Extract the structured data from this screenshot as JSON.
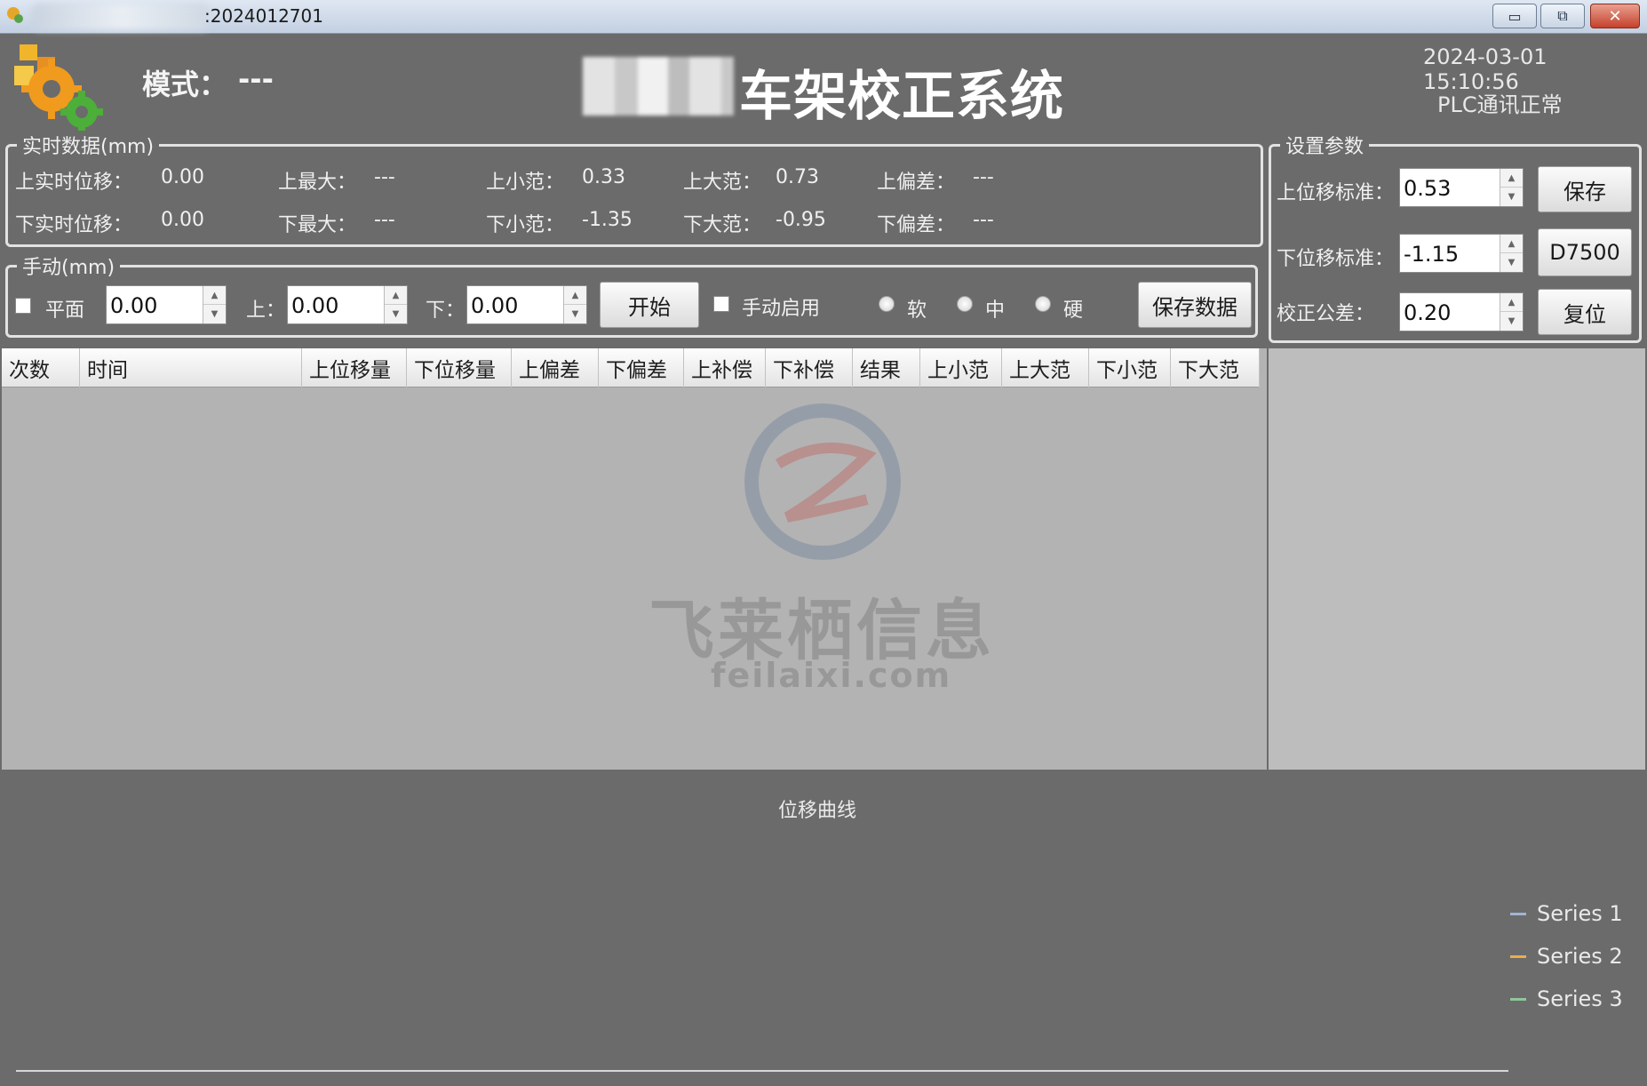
{
  "window": {
    "title_suffix": ":2024012701",
    "min_glyph": "▭",
    "max_glyph": "⧉",
    "close_glyph": "✕"
  },
  "header": {
    "mode_label": "模式：",
    "mode_value": "---",
    "system_title": "车架校正系统",
    "datetime": "2024-03-01 15:10:56",
    "plc_status": "PLC通讯正常"
  },
  "realtime": {
    "group_title": "实时数据(mm)",
    "upper_disp_label": "上实时位移：",
    "upper_disp_value": "0.00",
    "upper_max_label": "上最大：",
    "upper_max_value": "---",
    "upper_small_label": "上小范：",
    "upper_small_value": "0.33",
    "upper_big_label": "上大范：",
    "upper_big_value": "0.73",
    "upper_dev_label": "上偏差：",
    "upper_dev_value": "---",
    "lower_disp_label": "下实时位移：",
    "lower_disp_value": "0.00",
    "lower_max_label": "下最大：",
    "lower_max_value": "---",
    "lower_small_label": "下小范：",
    "lower_small_value": "-1.35",
    "lower_big_label": "下大范：",
    "lower_big_value": "-0.95",
    "lower_dev_label": "下偏差：",
    "lower_dev_value": "---"
  },
  "manual": {
    "group_title": "手动(mm)",
    "flat_label": "平面",
    "flat_value": "0.00",
    "upper_label": "上：",
    "upper_value": "0.00",
    "lower_label": "下：",
    "lower_value": "0.00",
    "start_button": "开始",
    "manual_enable_label": "手动启用",
    "radio_soft": "软",
    "radio_medium": "中",
    "radio_hard": "硬",
    "save_data_button": "保存数据"
  },
  "settings": {
    "group_title": "设置参数",
    "upper_std_label": "上位移标准：",
    "upper_std_value": "0.53",
    "lower_std_label": "下位移标准：",
    "lower_std_value": "-1.15",
    "tolerance_label": "校正公差：",
    "tolerance_value": "0.20",
    "save_button": "保存",
    "d7500_button": "D7500",
    "reset_button": "复位"
  },
  "table": {
    "columns": [
      "次数",
      "时间",
      "上位移量",
      "下位移量",
      "上偏差",
      "下偏差",
      "上补偿",
      "下补偿",
      "结果",
      "上小范",
      "上大范",
      "下小范",
      "下大范"
    ]
  },
  "watermark": {
    "text": "飞莱栖信息",
    "url": "feilaixi.com"
  },
  "chart": {
    "title": "位移曲线",
    "series": [
      {
        "name": "Series 1",
        "color": "#9fb6d3"
      },
      {
        "name": "Series 2",
        "color": "#e7b04a"
      },
      {
        "name": "Series 3",
        "color": "#8fc79a"
      }
    ]
  }
}
